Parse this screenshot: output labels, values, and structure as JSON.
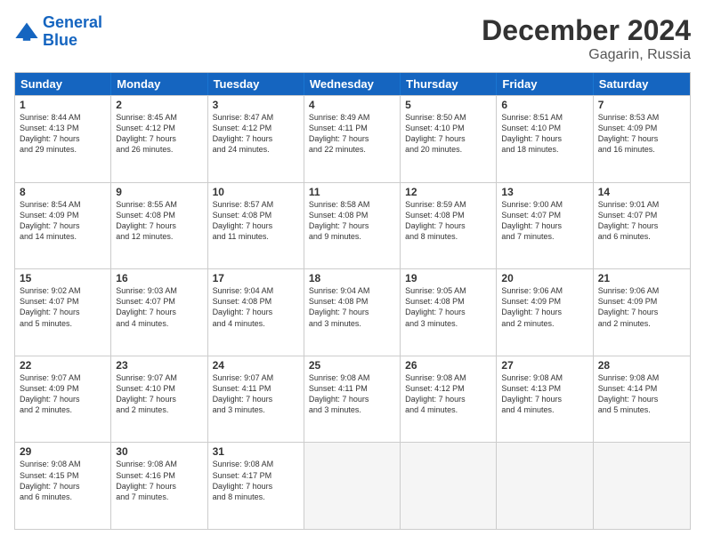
{
  "header": {
    "logo_line1": "General",
    "logo_line2": "Blue",
    "title": "December 2024",
    "subtitle": "Gagarin, Russia"
  },
  "days_of_week": [
    "Sunday",
    "Monday",
    "Tuesday",
    "Wednesday",
    "Thursday",
    "Friday",
    "Saturday"
  ],
  "weeks": [
    [
      {
        "day": 1,
        "lines": [
          "Sunrise: 8:44 AM",
          "Sunset: 4:13 PM",
          "Daylight: 7 hours",
          "and 29 minutes."
        ]
      },
      {
        "day": 2,
        "lines": [
          "Sunrise: 8:45 AM",
          "Sunset: 4:12 PM",
          "Daylight: 7 hours",
          "and 26 minutes."
        ]
      },
      {
        "day": 3,
        "lines": [
          "Sunrise: 8:47 AM",
          "Sunset: 4:12 PM",
          "Daylight: 7 hours",
          "and 24 minutes."
        ]
      },
      {
        "day": 4,
        "lines": [
          "Sunrise: 8:49 AM",
          "Sunset: 4:11 PM",
          "Daylight: 7 hours",
          "and 22 minutes."
        ]
      },
      {
        "day": 5,
        "lines": [
          "Sunrise: 8:50 AM",
          "Sunset: 4:10 PM",
          "Daylight: 7 hours",
          "and 20 minutes."
        ]
      },
      {
        "day": 6,
        "lines": [
          "Sunrise: 8:51 AM",
          "Sunset: 4:10 PM",
          "Daylight: 7 hours",
          "and 18 minutes."
        ]
      },
      {
        "day": 7,
        "lines": [
          "Sunrise: 8:53 AM",
          "Sunset: 4:09 PM",
          "Daylight: 7 hours",
          "and 16 minutes."
        ]
      }
    ],
    [
      {
        "day": 8,
        "lines": [
          "Sunrise: 8:54 AM",
          "Sunset: 4:09 PM",
          "Daylight: 7 hours",
          "and 14 minutes."
        ]
      },
      {
        "day": 9,
        "lines": [
          "Sunrise: 8:55 AM",
          "Sunset: 4:08 PM",
          "Daylight: 7 hours",
          "and 12 minutes."
        ]
      },
      {
        "day": 10,
        "lines": [
          "Sunrise: 8:57 AM",
          "Sunset: 4:08 PM",
          "Daylight: 7 hours",
          "and 11 minutes."
        ]
      },
      {
        "day": 11,
        "lines": [
          "Sunrise: 8:58 AM",
          "Sunset: 4:08 PM",
          "Daylight: 7 hours",
          "and 9 minutes."
        ]
      },
      {
        "day": 12,
        "lines": [
          "Sunrise: 8:59 AM",
          "Sunset: 4:08 PM",
          "Daylight: 7 hours",
          "and 8 minutes."
        ]
      },
      {
        "day": 13,
        "lines": [
          "Sunrise: 9:00 AM",
          "Sunset: 4:07 PM",
          "Daylight: 7 hours",
          "and 7 minutes."
        ]
      },
      {
        "day": 14,
        "lines": [
          "Sunrise: 9:01 AM",
          "Sunset: 4:07 PM",
          "Daylight: 7 hours",
          "and 6 minutes."
        ]
      }
    ],
    [
      {
        "day": 15,
        "lines": [
          "Sunrise: 9:02 AM",
          "Sunset: 4:07 PM",
          "Daylight: 7 hours",
          "and 5 minutes."
        ]
      },
      {
        "day": 16,
        "lines": [
          "Sunrise: 9:03 AM",
          "Sunset: 4:07 PM",
          "Daylight: 7 hours",
          "and 4 minutes."
        ]
      },
      {
        "day": 17,
        "lines": [
          "Sunrise: 9:04 AM",
          "Sunset: 4:08 PM",
          "Daylight: 7 hours",
          "and 4 minutes."
        ]
      },
      {
        "day": 18,
        "lines": [
          "Sunrise: 9:04 AM",
          "Sunset: 4:08 PM",
          "Daylight: 7 hours",
          "and 3 minutes."
        ]
      },
      {
        "day": 19,
        "lines": [
          "Sunrise: 9:05 AM",
          "Sunset: 4:08 PM",
          "Daylight: 7 hours",
          "and 3 minutes."
        ]
      },
      {
        "day": 20,
        "lines": [
          "Sunrise: 9:06 AM",
          "Sunset: 4:09 PM",
          "Daylight: 7 hours",
          "and 2 minutes."
        ]
      },
      {
        "day": 21,
        "lines": [
          "Sunrise: 9:06 AM",
          "Sunset: 4:09 PM",
          "Daylight: 7 hours",
          "and 2 minutes."
        ]
      }
    ],
    [
      {
        "day": 22,
        "lines": [
          "Sunrise: 9:07 AM",
          "Sunset: 4:09 PM",
          "Daylight: 7 hours",
          "and 2 minutes."
        ]
      },
      {
        "day": 23,
        "lines": [
          "Sunrise: 9:07 AM",
          "Sunset: 4:10 PM",
          "Daylight: 7 hours",
          "and 2 minutes."
        ]
      },
      {
        "day": 24,
        "lines": [
          "Sunrise: 9:07 AM",
          "Sunset: 4:11 PM",
          "Daylight: 7 hours",
          "and 3 minutes."
        ]
      },
      {
        "day": 25,
        "lines": [
          "Sunrise: 9:08 AM",
          "Sunset: 4:11 PM",
          "Daylight: 7 hours",
          "and 3 minutes."
        ]
      },
      {
        "day": 26,
        "lines": [
          "Sunrise: 9:08 AM",
          "Sunset: 4:12 PM",
          "Daylight: 7 hours",
          "and 4 minutes."
        ]
      },
      {
        "day": 27,
        "lines": [
          "Sunrise: 9:08 AM",
          "Sunset: 4:13 PM",
          "Daylight: 7 hours",
          "and 4 minutes."
        ]
      },
      {
        "day": 28,
        "lines": [
          "Sunrise: 9:08 AM",
          "Sunset: 4:14 PM",
          "Daylight: 7 hours",
          "and 5 minutes."
        ]
      }
    ],
    [
      {
        "day": 29,
        "lines": [
          "Sunrise: 9:08 AM",
          "Sunset: 4:15 PM",
          "Daylight: 7 hours",
          "and 6 minutes."
        ]
      },
      {
        "day": 30,
        "lines": [
          "Sunrise: 9:08 AM",
          "Sunset: 4:16 PM",
          "Daylight: 7 hours",
          "and 7 minutes."
        ]
      },
      {
        "day": 31,
        "lines": [
          "Sunrise: 9:08 AM",
          "Sunset: 4:17 PM",
          "Daylight: 7 hours",
          "and 8 minutes."
        ]
      },
      null,
      null,
      null,
      null
    ]
  ]
}
